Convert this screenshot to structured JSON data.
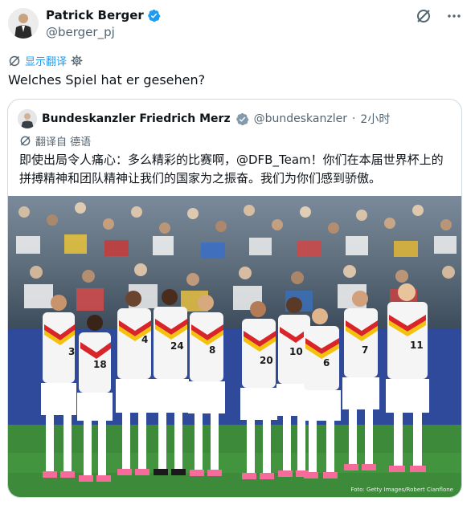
{
  "author": {
    "name": "Patrick Berger",
    "handle": "@berger_pj",
    "verified": true
  },
  "icons": {
    "grok": "grok-icon",
    "more": "more-icon",
    "translate": "translate-icon",
    "settings": "gear-icon",
    "verified": "verified-badge-icon"
  },
  "translate": {
    "label": "显示翻译"
  },
  "tweet": {
    "text": "Welches Spiel hat er gesehen?"
  },
  "quote": {
    "name": "Bundeskanzler Friedrich Merz",
    "handle": "@bundeskanzler",
    "separator": "·",
    "time": "2小时",
    "translated_from": "翻译自 德语",
    "text": "即使出局令人痛心：多么精彩的比赛啊，@DFB_Team！你们在本届世界杯上的拼搏精神和团队精神让我们的国家为之振奋。我们为你们感到骄傲。",
    "photo_credit": "Foto: Getty Images/Robert Cianflone",
    "jersey_numbers": [
      "3",
      "18",
      "4",
      "24",
      "8",
      "20",
      "10",
      "6",
      "7",
      "11"
    ]
  },
  "colors": {
    "accent": "#1d9bf0",
    "text": "#0f1419",
    "secondary": "#536471",
    "border": "#cfd9de",
    "pitch": "#3c8a3a"
  }
}
